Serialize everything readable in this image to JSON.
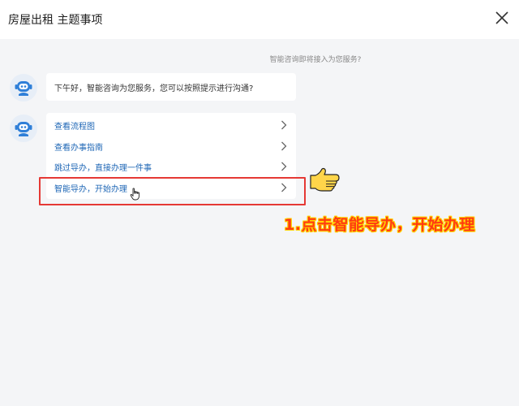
{
  "header": {
    "title": "房屋出租 主题事项"
  },
  "chat": {
    "notice": "智能咨询即将接入为您服务?",
    "greeting": "下午好，智能咨询为您服务，您可以按照提示进行沟通?",
    "options": [
      {
        "label": "查看流程图"
      },
      {
        "label": "查看办事指南"
      },
      {
        "label": "跳过导办，直接办理一件事"
      },
      {
        "label": "智能导办，开始办理"
      }
    ]
  },
  "annotation": {
    "text": "1.点击智能导办，开始办理"
  },
  "colors": {
    "link": "#1f67b6",
    "highlight": "#e53935",
    "annotation": "#ff3b12",
    "annotation_outline": "#ffd200",
    "hand_fill": "#ffd54a"
  },
  "icons": {
    "close": "close-icon",
    "bot": "robot-avatar-icon",
    "chevron": "chevron-right-icon",
    "cursor": "hand-cursor-icon",
    "pointer": "pointing-hand-icon"
  }
}
